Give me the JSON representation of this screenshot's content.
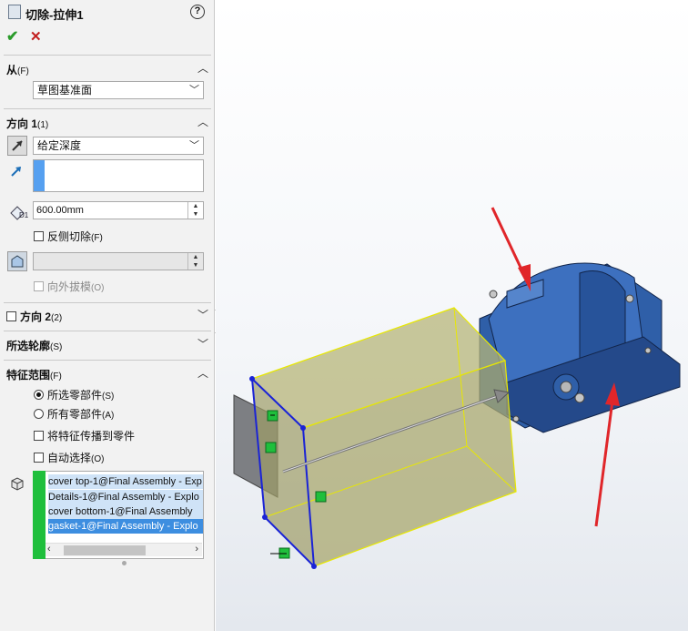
{
  "feature": {
    "title": "切除-拉伸1",
    "help_label": "?"
  },
  "actions": {
    "ok_label": "✔",
    "cancel_label": "✕"
  },
  "from_section": {
    "title": "从",
    "hotkey": "(F)",
    "dropdown_value": "草图基准面"
  },
  "direction1": {
    "title": "方向 1",
    "hotkey": "(1)",
    "end_condition": "给定深度",
    "depth_value": "600.00mm",
    "flip_side_label": "反侧切除",
    "flip_side_hotkey": "(F)",
    "draft_outward_label": "向外拔模",
    "draft_outward_hotkey": "(O)"
  },
  "direction2": {
    "title": "方向 2",
    "hotkey": "(2)"
  },
  "selected_contours": {
    "title": "所选轮廓",
    "hotkey": "(S)"
  },
  "feature_scope": {
    "title": "特征范围",
    "hotkey": "(F)",
    "options": [
      {
        "label": "所选零部件",
        "hotkey": "(S)"
      },
      {
        "label": "所有零部件",
        "hotkey": "(A)"
      }
    ],
    "propagate_label": "将特征传播到零件",
    "auto_select_label": "自动选择",
    "auto_select_hotkey": "(O)",
    "bodies": [
      "cover top-1@Final Assembly - Exp",
      "Details-1@Final Assembly - Explo",
      "cover bottom-1@Final Assembly",
      "gasket-1@Final Assembly - Explo"
    ]
  },
  "colors": {
    "accent_green": "#1fbf3c",
    "accent_blue": "#56a0f0",
    "part_blue": "#2f5fa8",
    "cut_box_yellow": "#e8e800",
    "arrow_red": "#e0262a"
  }
}
